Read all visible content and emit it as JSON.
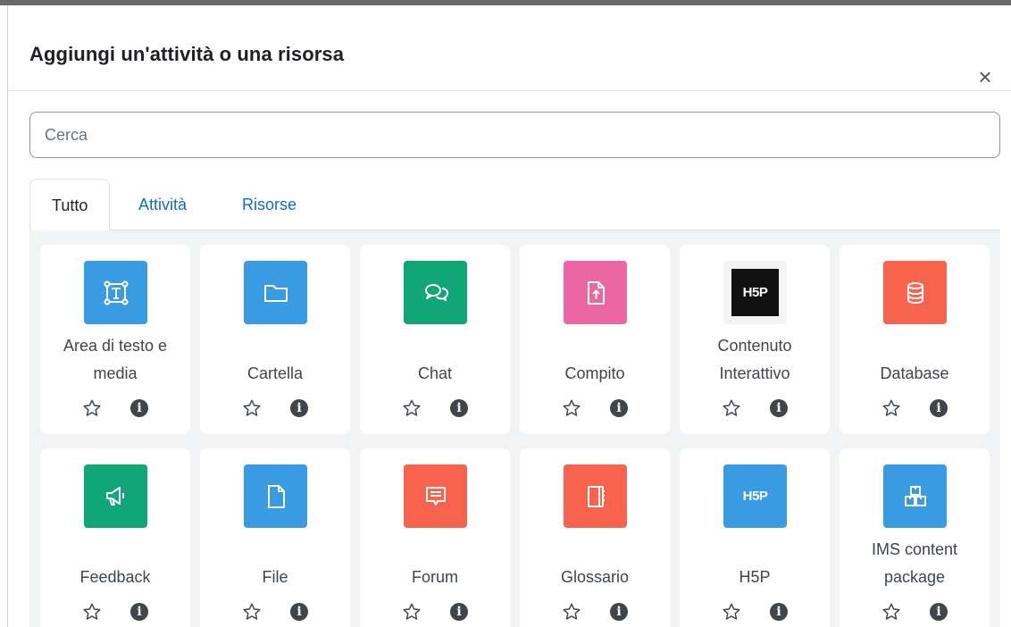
{
  "modal": {
    "title": "Aggiungi un'attività o una risorsa",
    "close_icon": "×"
  },
  "search": {
    "placeholder": "Cerca",
    "value": ""
  },
  "tabs": [
    {
      "label": "Tutto",
      "active": true
    },
    {
      "label": "Attività",
      "active": false
    },
    {
      "label": "Risorse",
      "active": false
    }
  ],
  "colors": {
    "blue": "#399be2",
    "green": "#11a676",
    "pink": "#eb66a2",
    "orange": "#f7634d",
    "link": "#0f6cbf",
    "h5p_dark": "#111111"
  },
  "items": [
    {
      "label": "Area di testo e media",
      "icon": "text-media-icon",
      "color": "#399be2"
    },
    {
      "label": "Cartella",
      "icon": "folder-icon",
      "color": "#399be2"
    },
    {
      "label": "Chat",
      "icon": "chat-bubbles-icon",
      "color": "#11a676"
    },
    {
      "label": "Compito",
      "icon": "assignment-upload-icon",
      "color": "#eb66a2"
    },
    {
      "label": "Contenuto Interattivo",
      "icon": "h5p-logo-icon",
      "color": "#f2f3f5"
    },
    {
      "label": "Database",
      "icon": "database-icon",
      "color": "#f7634d"
    },
    {
      "label": "Feedback",
      "icon": "megaphone-icon",
      "color": "#11a676"
    },
    {
      "label": "File",
      "icon": "file-icon",
      "color": "#399be2"
    },
    {
      "label": "Forum",
      "icon": "forum-icon",
      "color": "#f7634d"
    },
    {
      "label": "Glossario",
      "icon": "glossary-book-icon",
      "color": "#f7634d"
    },
    {
      "label": "H5P",
      "icon": "h5p-logo-icon",
      "color": "#399be2"
    },
    {
      "label": "IMS content package",
      "icon": "package-icon",
      "color": "#399be2"
    }
  ]
}
